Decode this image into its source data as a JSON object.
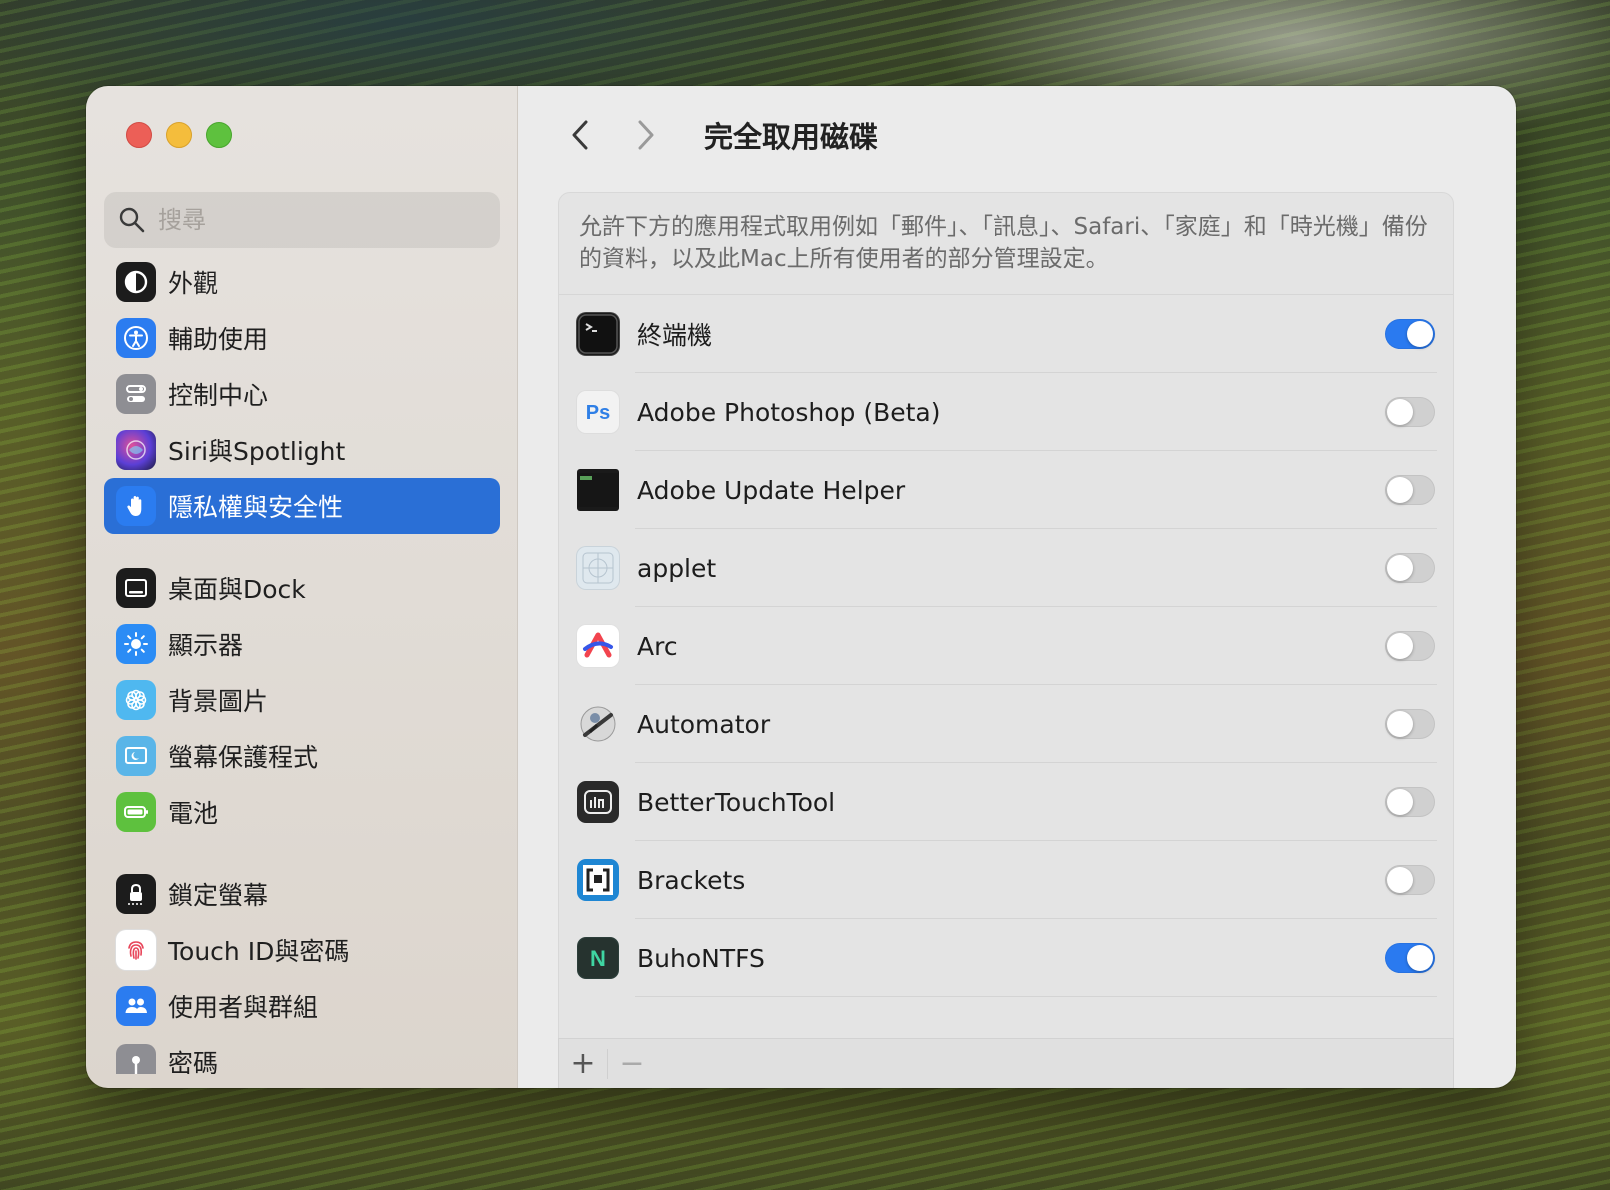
{
  "window": {
    "title": "完全取用磁碟"
  },
  "search": {
    "placeholder": "搜尋"
  },
  "sidebar": {
    "items": [
      {
        "label": "外觀",
        "icon": "appearance-icon",
        "color": "#1c1c1c"
      },
      {
        "label": "輔助使用",
        "icon": "accessibility-icon",
        "color": "#2b7cf0"
      },
      {
        "label": "控制中心",
        "icon": "control-center-icon",
        "color": "#8e8e93"
      },
      {
        "label": "Siri與Spotlight",
        "icon": "siri-icon",
        "color": "#6b3fd0"
      },
      {
        "label": "隱私權與安全性",
        "icon": "hand-icon",
        "color": "#2b7cf0",
        "active": true
      },
      {
        "label": "桌面與Dock",
        "icon": "dock-icon",
        "color": "#1c1c1c"
      },
      {
        "label": "顯示器",
        "icon": "display-icon",
        "color": "#2b8cf5"
      },
      {
        "label": "背景圖片",
        "icon": "wallpaper-icon",
        "color": "#4fb8f0"
      },
      {
        "label": "螢幕保護程式",
        "icon": "screensaver-icon",
        "color": "#5ab5e8"
      },
      {
        "label": "電池",
        "icon": "battery-icon",
        "color": "#5ec13e"
      },
      {
        "label": "鎖定螢幕",
        "icon": "lock-icon",
        "color": "#1c1c1c"
      },
      {
        "label": "Touch ID與密碼",
        "icon": "fingerprint-icon",
        "color": "#ffffff"
      },
      {
        "label": "使用者與群組",
        "icon": "users-icon",
        "color": "#2b7cf0"
      },
      {
        "label": "密碼",
        "icon": "key-icon",
        "color": "#8e8e93"
      }
    ]
  },
  "panel": {
    "description": "允許下方的應用程式取用例如「郵件」、「訊息」、Safari、「家庭」和「時光機」備份的資料，以及此Mac上所有使用者的部分管理設定。",
    "apps": [
      {
        "name": "終端機",
        "icon": "terminal-icon",
        "enabled": true
      },
      {
        "name": "Adobe Photoshop (Beta)",
        "icon": "photoshop-icon",
        "enabled": false
      },
      {
        "name": "Adobe Update Helper",
        "icon": "exec-icon",
        "enabled": false
      },
      {
        "name": "applet",
        "icon": "applet-icon",
        "enabled": false
      },
      {
        "name": "Arc",
        "icon": "arc-icon",
        "enabled": false
      },
      {
        "name": "Automator",
        "icon": "automator-icon",
        "enabled": false
      },
      {
        "name": "BetterTouchTool",
        "icon": "bettertouchtool-icon",
        "enabled": false
      },
      {
        "name": "Brackets",
        "icon": "brackets-icon",
        "enabled": false
      },
      {
        "name": "BuhoNTFS",
        "icon": "buhontfs-icon",
        "enabled": true
      }
    ]
  },
  "footer": {
    "add_label": "+",
    "remove_label": "−"
  },
  "colors": {
    "accent": "#2a7af0",
    "annotation_arrow": "#e8664a"
  }
}
